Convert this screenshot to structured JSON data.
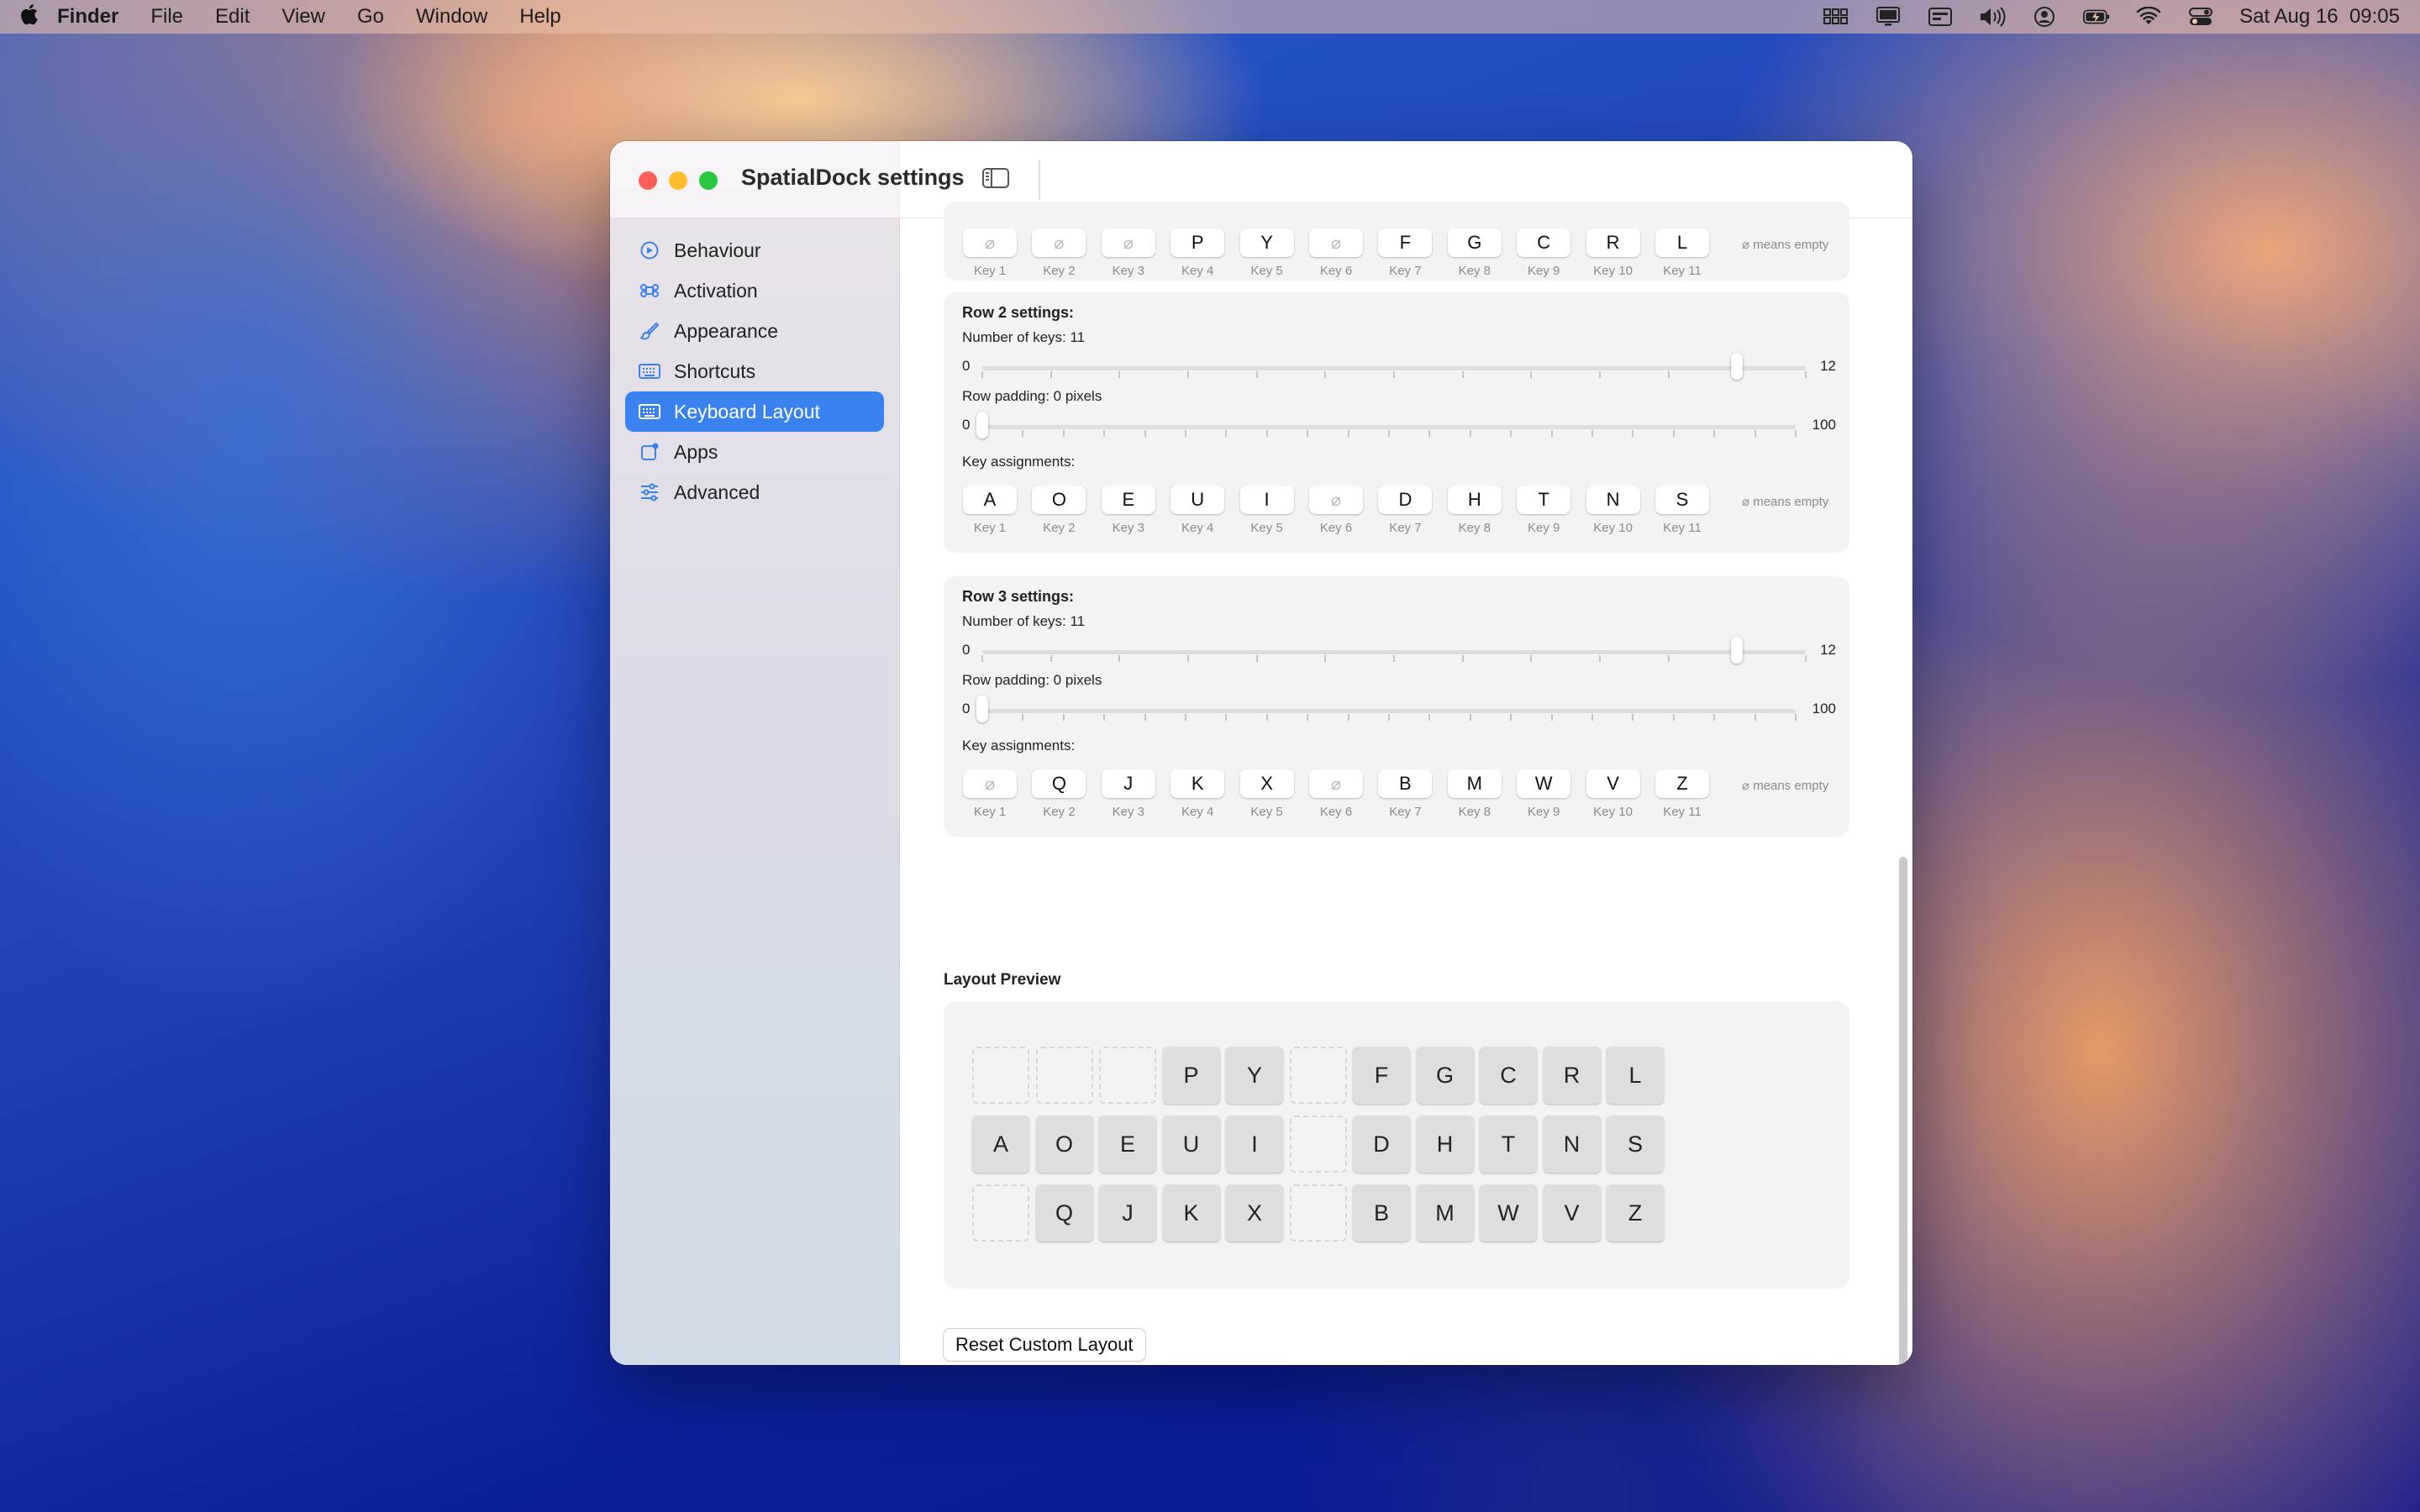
{
  "menubar": {
    "app": "Finder",
    "items": [
      "File",
      "Edit",
      "View",
      "Go",
      "Window",
      "Help"
    ],
    "clock": "Sat Aug 16  09:05",
    "status_icons": [
      "grid-icon",
      "display-icon",
      "keyboard-viewer-icon",
      "volume-icon",
      "user-icon",
      "battery-icon",
      "wifi-icon",
      "control-center-icon"
    ]
  },
  "window": {
    "title": "SpatialDock settings"
  },
  "sidebar": {
    "items": [
      {
        "label": "Behaviour",
        "icon": "behaviour-icon"
      },
      {
        "label": "Activation",
        "icon": "command-icon"
      },
      {
        "label": "Appearance",
        "icon": "brush-icon"
      },
      {
        "label": "Shortcuts",
        "icon": "keyboard-icon"
      },
      {
        "label": "Keyboard Layout",
        "icon": "keyboard-icon",
        "active": true
      },
      {
        "label": "Apps",
        "icon": "apps-icon"
      },
      {
        "label": "Advanced",
        "icon": "sliders-icon"
      }
    ]
  },
  "key_labels": [
    "Key 1",
    "Key 2",
    "Key 3",
    "Key 4",
    "Key 5",
    "Key 6",
    "Key 7",
    "Key 8",
    "Key 9",
    "Key 10",
    "Key 11"
  ],
  "empty_note": "⌀ means empty",
  "row1": {
    "keys": [
      "⌀",
      "⌀",
      "⌀",
      "P",
      "Y",
      "⌀",
      "F",
      "G",
      "C",
      "R",
      "L"
    ]
  },
  "row2": {
    "title": "Row 2 settings:",
    "num_keys_label": "Number of keys: 11",
    "num_keys": {
      "min": "0",
      "max": "12",
      "value": 11
    },
    "padding_label": "Row padding: 0 pixels",
    "padding": {
      "min": "0",
      "max": "100",
      "value": 0
    },
    "assign_label": "Key assignments:",
    "keys": [
      "A",
      "O",
      "E",
      "U",
      "I",
      "⌀",
      "D",
      "H",
      "T",
      "N",
      "S"
    ]
  },
  "row3": {
    "title": "Row 3 settings:",
    "num_keys_label": "Number of keys: 11",
    "num_keys": {
      "min": "0",
      "max": "12",
      "value": 11
    },
    "padding_label": "Row padding: 0 pixels",
    "padding": {
      "min": "0",
      "max": "100",
      "value": 0
    },
    "assign_label": "Key assignments:",
    "keys": [
      "⌀",
      "Q",
      "J",
      "K",
      "X",
      "⌀",
      "B",
      "M",
      "W",
      "V",
      "Z"
    ]
  },
  "preview": {
    "title": "Layout Preview",
    "rows": [
      [
        "",
        "",
        "",
        "P",
        "Y",
        "",
        "F",
        "G",
        "C",
        "R",
        "L"
      ],
      [
        "A",
        "O",
        "E",
        "U",
        "I",
        "",
        "D",
        "H",
        "T",
        "N",
        "S"
      ],
      [
        "",
        "Q",
        "J",
        "K",
        "X",
        "",
        "B",
        "M",
        "W",
        "V",
        "Z"
      ]
    ]
  },
  "reset_button": "Reset Custom Layout",
  "colors": {
    "accent": "#3a82f0",
    "close": "#ff5f57",
    "minimize": "#febc2e",
    "zoom": "#28c840"
  }
}
